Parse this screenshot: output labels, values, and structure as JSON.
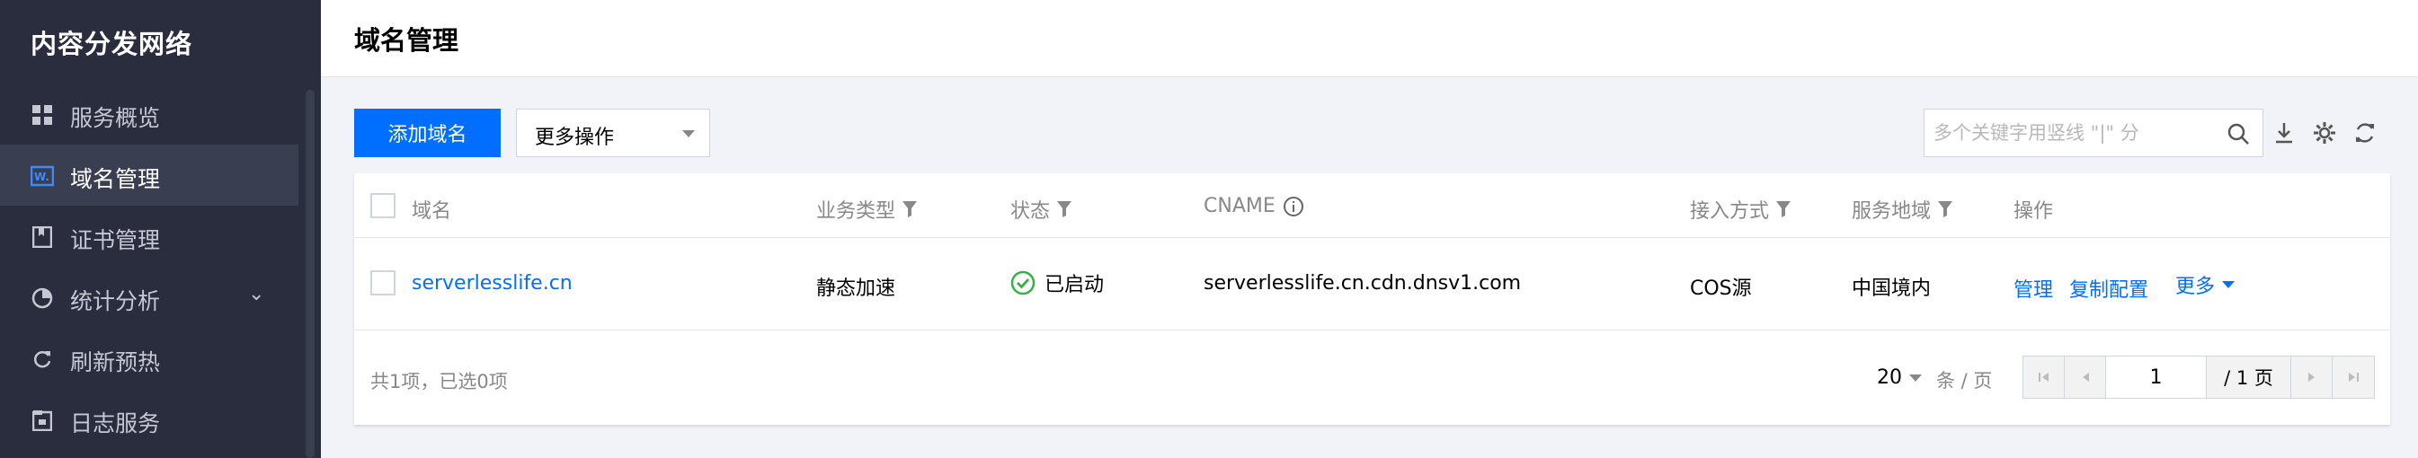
{
  "sidebar": {
    "brand": "内容分发网络",
    "items": [
      {
        "label": "服务概览",
        "icon": "grid-icon"
      },
      {
        "label": "域名管理",
        "icon": "domain-icon",
        "active": true
      },
      {
        "label": "证书管理",
        "icon": "certificate-icon"
      },
      {
        "label": "统计分析",
        "icon": "pie-chart-icon",
        "expandable": true
      },
      {
        "label": "刷新预热",
        "icon": "refresh-icon"
      },
      {
        "label": "日志服务",
        "icon": "log-icon"
      }
    ]
  },
  "header": {
    "title": "域名管理"
  },
  "toolbar": {
    "add_label": "添加域名",
    "more_ops_label": "更多操作",
    "search_placeholder": "多个关键字用竖线 \"|\" 分",
    "tools": [
      "download-icon",
      "settings-icon",
      "refresh-icon"
    ]
  },
  "table": {
    "columns": {
      "domain": "域名",
      "type": "业务类型",
      "status": "状态",
      "cname": "CNAME",
      "access": "接入方式",
      "region": "服务地域",
      "ops": "操作"
    },
    "rows": [
      {
        "domain": "serverlesslife.cn",
        "type": "静态加速",
        "status": "已启动",
        "cname": "serverlesslife.cn.cdn.dnsv1.com",
        "access": "COS源",
        "region": "中国境内",
        "op_manage": "管理",
        "op_copy": "复制配置",
        "op_more": "更多"
      }
    ]
  },
  "footer": {
    "total": "共1项，已选0项",
    "page_size": "20",
    "page_size_unit": "条 / 页",
    "page_input": "1",
    "page_total": "/ 1 页"
  },
  "colors": {
    "primary": "#006eff",
    "sidebar_bg": "#292d3e",
    "success": "#34b344"
  }
}
